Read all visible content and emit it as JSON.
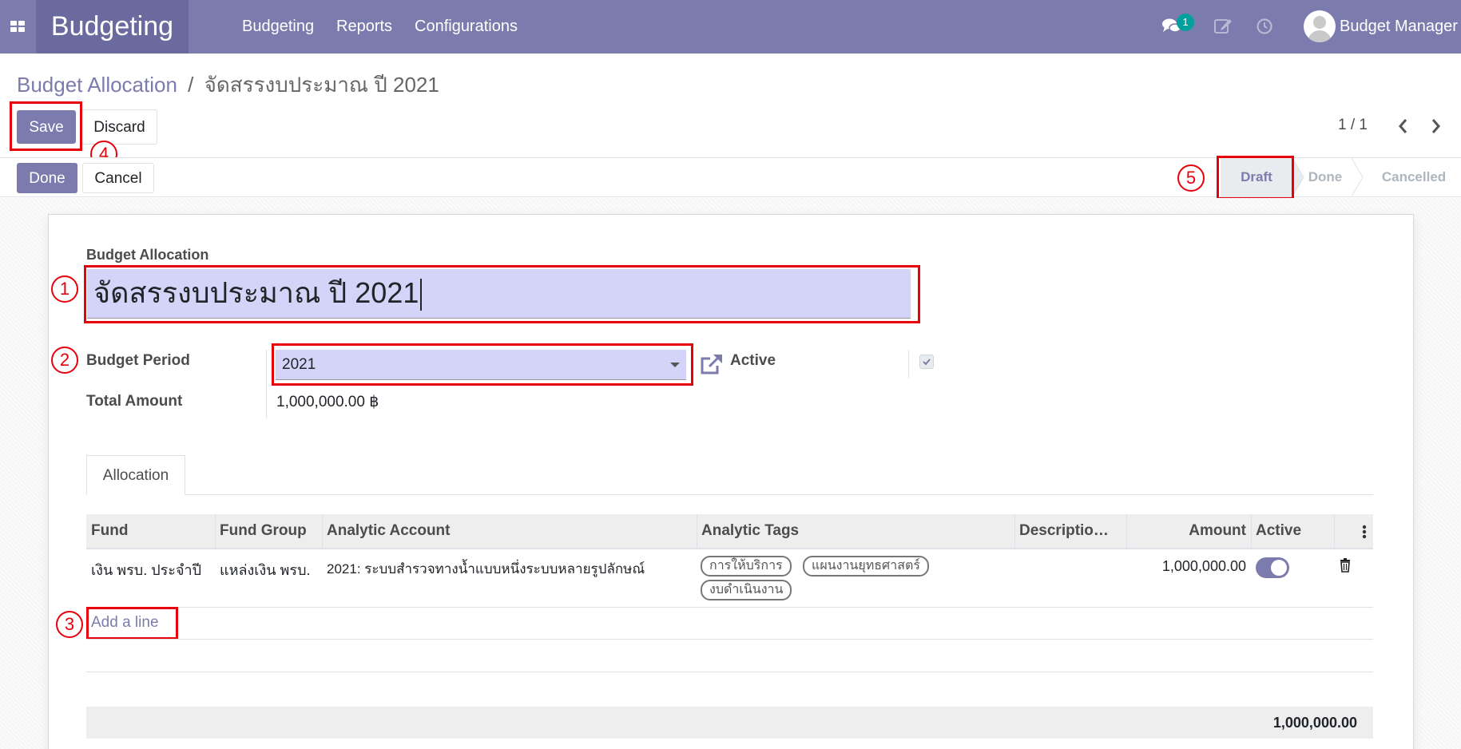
{
  "navbar": {
    "brand": "Budgeting",
    "menu": [
      "Budgeting",
      "Reports",
      "Configurations"
    ],
    "notification_count": "1",
    "user_name": "Budget Manager"
  },
  "breadcrumb": {
    "parent": "Budget Allocation",
    "separator": "/",
    "current": "จัดสรรงบประมาณ ปี 2021"
  },
  "buttons": {
    "save": "Save",
    "discard": "Discard",
    "done": "Done",
    "cancel": "Cancel"
  },
  "pager": "1 / 1",
  "statusbar": {
    "stages": [
      "Draft",
      "Done",
      "Cancelled"
    ],
    "active_stage": "Draft"
  },
  "annotations": [
    "1",
    "2",
    "3",
    "4",
    "5"
  ],
  "form": {
    "name_label": "Budget Allocation",
    "name_value": "จัดสรรงบประมาณ ปี 2021",
    "budget_period_label": "Budget Period",
    "budget_period_value": "2021",
    "total_amount_label": "Total Amount",
    "total_amount_value": "1,000,000.00 ฿",
    "active_label": "Active",
    "active_checked": true
  },
  "tabs": [
    "Allocation"
  ],
  "table": {
    "columns": [
      "Fund",
      "Fund Group",
      "Analytic Account",
      "Analytic Tags",
      "Descriptio…",
      "Amount",
      "Active"
    ],
    "rows": [
      {
        "fund": "เงิน พรบ. ประจำปี",
        "fund_group": "แหล่งเงิน พรบ.",
        "analytic_account": "2021: ระบบสำรวจทางน้ำแบบหนึ่งระบบหลายรูปลักษณ์",
        "tags": [
          "การให้บริการ",
          "แผนงานยุทธศาสตร์",
          "งบดำเนินงาน"
        ],
        "description": "",
        "amount": "1,000,000.00",
        "active": true
      }
    ],
    "add_line": "Add a line",
    "footer_total": "1,000,000.00"
  },
  "colors": {
    "primary": "#7c7bad",
    "brand_bg": "#6a6a9e",
    "highlight": "#e8000b",
    "input_bg": "#d4d4f8",
    "badge": "#00a09d"
  }
}
